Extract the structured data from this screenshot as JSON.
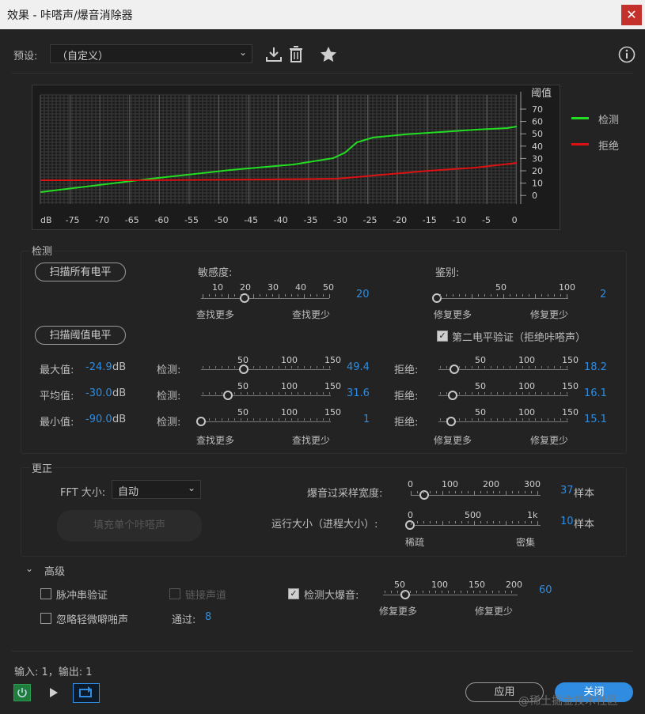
{
  "window": {
    "title": "效果 - 咔嗒声/爆音消除器",
    "close": "✕"
  },
  "preset": {
    "label": "预设:",
    "value": "（自定义）"
  },
  "graph": {
    "legend": [
      {
        "name": "检测",
        "color": "#22dd22"
      },
      {
        "name": "拒绝",
        "color": "#dd1111"
      }
    ],
    "y_title": "阈值",
    "y_ticks": [
      "70",
      "60",
      "50",
      "40",
      "30",
      "20",
      "10",
      "0"
    ],
    "x_ticks": [
      "dB",
      "-75",
      "-70",
      "-65",
      "-60",
      "-55",
      "-50",
      "-45",
      "-40",
      "-35",
      "-30",
      "-25",
      "-20",
      "-15",
      "-10",
      "-5",
      "0"
    ]
  },
  "detect": {
    "section": "检测",
    "scan_all": "扫描所有电平",
    "scan_threshold": "扫描阈值电平",
    "sensitivity": {
      "label": "敏感度:",
      "ticks": [
        "10",
        "20",
        "30",
        "40",
        "50"
      ],
      "value": "20",
      "left": "查找更多",
      "right": "查找更少"
    },
    "discrimination": {
      "label": "鉴别:",
      "ticks": [
        "50",
        "100"
      ],
      "value": "2",
      "left": "修复更多",
      "right": "修复更少"
    },
    "second_level": {
      "label": "第二电平验证（拒绝咔嗒声）",
      "checked": true
    },
    "rows": [
      {
        "name": "最大值:",
        "db": "-24.9",
        "unit": "dB",
        "detect_label": "检测:",
        "detect": "49.4",
        "reject_label": "拒绝:",
        "reject": "18.2",
        "dlevel": 0.33,
        "rlevel": 0.12
      },
      {
        "name": "平均值:",
        "db": "-30.0",
        "unit": "dB",
        "detect_label": "检测:",
        "detect": "31.6",
        "reject_label": "拒绝:",
        "reject": "16.1",
        "dlevel": 0.21,
        "rlevel": 0.11
      },
      {
        "name": "最小值:",
        "db": "-90.0",
        "unit": "dB",
        "detect_label": "检测:",
        "detect": "1",
        "reject_label": "拒绝:",
        "reject": "15.1",
        "dlevel": 0.0,
        "rlevel": 0.1
      }
    ],
    "scale_ticks": [
      "50",
      "100",
      "150"
    ],
    "bottom_left": "查找更多",
    "bottom_right": "查找更少",
    "bottom_left2": "修复更多",
    "bottom_right2": "修复更少"
  },
  "correct": {
    "section": "更正",
    "fft_label": "FFT 大小:",
    "fft_value": "自动",
    "fill_button": "填充单个咔嗒声",
    "pop_label": "爆音过采样宽度:",
    "pop_ticks": [
      "0",
      "100",
      "200",
      "300"
    ],
    "pop_value": "37",
    "pop_unit": "样本",
    "run_label": "运行大小（进程大小）:",
    "run_ticks": [
      "0",
      "500",
      "1k"
    ],
    "run_value": "10",
    "run_unit": "样本",
    "sparse": "稀疏",
    "dense": "密集"
  },
  "advanced": {
    "section": "高级",
    "pulse": "脉冲串验证",
    "link": "链接声道",
    "big_pop": "检测大爆音:",
    "ignore": "忽略轻微噼啪声",
    "pass_label": "通过:",
    "pass_value": "8",
    "big_ticks": [
      "50",
      "100",
      "150",
      "200"
    ],
    "big_value": "60",
    "left": "修复更多",
    "right": "修复更少"
  },
  "footer": {
    "io": "输入: 1，输出: 1",
    "apply": "应用",
    "close": "关闭",
    "watermark": "@稀土掘金技术社区"
  }
}
